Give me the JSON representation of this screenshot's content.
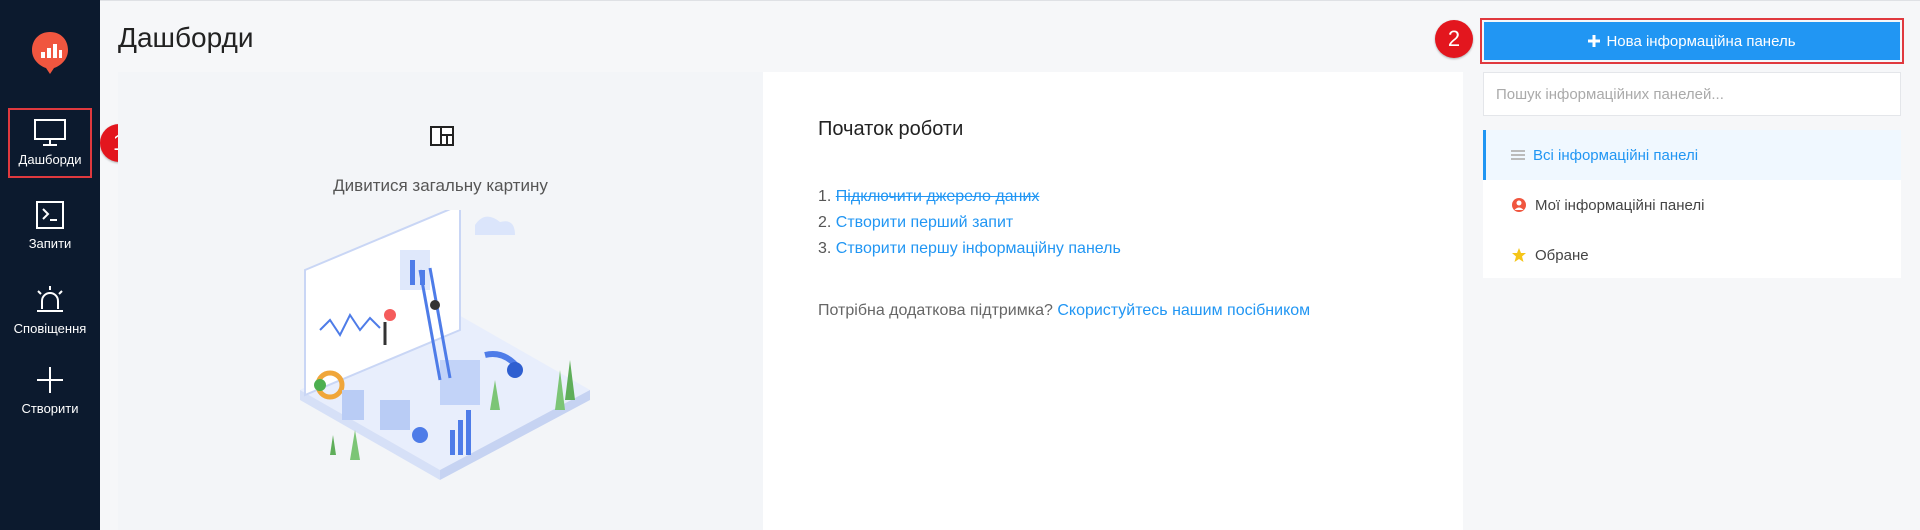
{
  "sidebar": {
    "items": [
      {
        "label": "Дашборди",
        "icon": "monitor-icon",
        "active": true
      },
      {
        "label": "Запити",
        "icon": "terminal-icon"
      },
      {
        "label": "Сповіщення",
        "icon": "alarm-icon"
      },
      {
        "label": "Створити",
        "icon": "plus-icon"
      }
    ]
  },
  "callouts": [
    "1",
    "2"
  ],
  "page": {
    "title": "Дашборди"
  },
  "overview": {
    "text": "Дивитися загальну картину"
  },
  "getting_started": {
    "title": "Початок роботи",
    "steps": [
      {
        "num": "1.",
        "label": "Підключити джерело даних",
        "done": true
      },
      {
        "num": "2.",
        "label": "Створити перший запит"
      },
      {
        "num": "3.",
        "label": "Створити першу інформаційну панель"
      }
    ],
    "help_text": "Потрібна додаткова підтримка?",
    "help_link": "Скористуйтесь нашим посібником"
  },
  "right": {
    "new_button": "Нова інформаційна панель",
    "search_placeholder": "Пошук інформаційних панелей...",
    "filters": [
      {
        "label": "Всі інформаційні панелі",
        "icon": "list-icon",
        "active": true
      },
      {
        "label": "Мої інформаційні панелі",
        "icon": "user-badge-icon"
      },
      {
        "label": "Обране",
        "icon": "star-icon"
      }
    ]
  },
  "colors": {
    "sidebar_bg": "#0c1a2e",
    "accent": "#2196f3",
    "callout": "#e3161e",
    "logo": "#f0563f"
  }
}
